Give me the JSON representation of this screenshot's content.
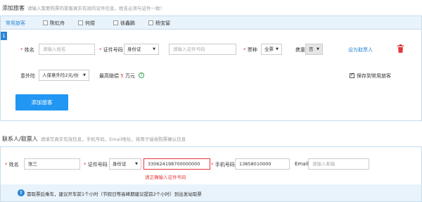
{
  "passenger_section": {
    "title": "添加旅客",
    "hint": "请输入需要购票的旅客真实有效的证件信息，姓名必须与证件一致！"
  },
  "frequent": {
    "label": "常用旅客",
    "names": [
      "陈虹舟",
      "何煜",
      "徐鑫鹏",
      "杨宝留"
    ]
  },
  "passenger_form": {
    "index": "1",
    "name_label": "姓名",
    "name_placeholder": "请输入姓名",
    "idtype_label": "证件号码",
    "idtype_value": "身份证",
    "idno_placeholder": "请输入证件号码",
    "ticket_label": "票种",
    "ticket_value": "全票",
    "infant_label": "携童",
    "infant_value": "否",
    "set_contact_link": "设为取票人",
    "insurance_label": "意外险",
    "insurance_value": "人保意外险2元/份",
    "max_comp_label": "最高赔偿",
    "max_comp_amount": "5",
    "max_comp_unit": "万元",
    "save_label": "保存到常用旅客",
    "required_mark": "*"
  },
  "add_button": "添加旅客",
  "contact_section": {
    "title": "联系人/取票人",
    "hint": "请填写真实有效信息，手机号码，Email地址，将用于接收购票确认信息"
  },
  "contact_form": {
    "name_label": "姓名",
    "name_value": "张三",
    "idtype_label": "证件号码",
    "idtype_value": "身份证",
    "idno_value": "330624198700000000",
    "idno_error": "请正确输入证件号码",
    "phone_label": "手机号码",
    "phone_value": "13858010000",
    "email_label": "Email",
    "email_placeholder": "请输入邮箱",
    "required_mark": "*"
  },
  "tip": {
    "icon": "!",
    "text": "需取票后乘车，建议开车前1个小时（节假日等高峰期建议提前2个小时）到出发站取票"
  },
  "colors": {
    "accent": "#2196f3",
    "link": "#2a84d4",
    "error": "#e4393c"
  }
}
